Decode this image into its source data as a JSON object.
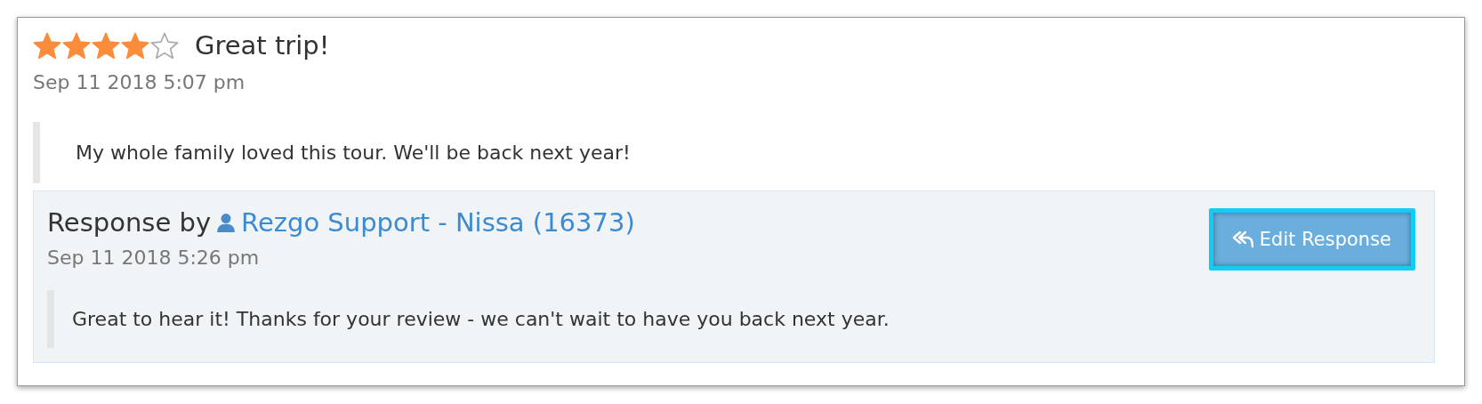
{
  "review": {
    "stars": 4,
    "title": "Great trip!",
    "date": "Sep 11 2018 5:07 pm",
    "text": "My whole family loved this tour. We'll be back next year!"
  },
  "response": {
    "label": "Response by",
    "author": "Rezgo Support - Nissa (16373)",
    "date": "Sep 11 2018 5:26 pm",
    "text": "Great to hear it! Thanks for your review - we can't wait to have you back next year.",
    "button": {
      "label": "Edit Response",
      "highlighted": true
    }
  }
}
